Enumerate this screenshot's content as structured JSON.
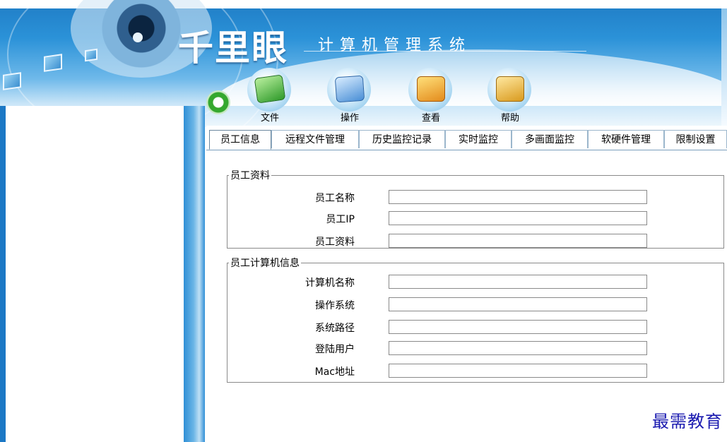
{
  "app": {
    "logo_main": "千里眼",
    "logo_sub": "计算机管理系统"
  },
  "toolbar": [
    {
      "label": "文件",
      "icon": "folder-icon"
    },
    {
      "label": "操作",
      "icon": "folder-blue-icon"
    },
    {
      "label": "查看",
      "icon": "magnifier-icon"
    },
    {
      "label": "帮助",
      "icon": "magic-lamp-icon"
    }
  ],
  "tabs": [
    {
      "label": "员工信息",
      "active": true
    },
    {
      "label": "远程文件管理",
      "active": false
    },
    {
      "label": "历史监控记录",
      "active": false
    },
    {
      "label": "实时监控",
      "active": false
    },
    {
      "label": "多画面监控",
      "active": false
    },
    {
      "label": "软硬件管理",
      "active": false
    },
    {
      "label": "限制设置",
      "active": false
    }
  ],
  "employee_info": {
    "legend": "员工资料",
    "fields": [
      {
        "label": "员工名称",
        "value": ""
      },
      {
        "label": "员工IP",
        "value": ""
      },
      {
        "label": "员工资料",
        "value": ""
      }
    ]
  },
  "computer_info": {
    "legend": "员工计算机信息",
    "fields": [
      {
        "label": "计算机名称",
        "value": ""
      },
      {
        "label": "操作系统",
        "value": ""
      },
      {
        "label": "系统路径",
        "value": ""
      },
      {
        "label": "登陆用户",
        "value": ""
      },
      {
        "label": "Mac地址",
        "value": ""
      }
    ]
  },
  "watermark": "最需教育",
  "colors": {
    "banner_blue": "#2b92d8",
    "sidebar_blue": "#1b78c5",
    "watermark": "#1b1bb0"
  }
}
